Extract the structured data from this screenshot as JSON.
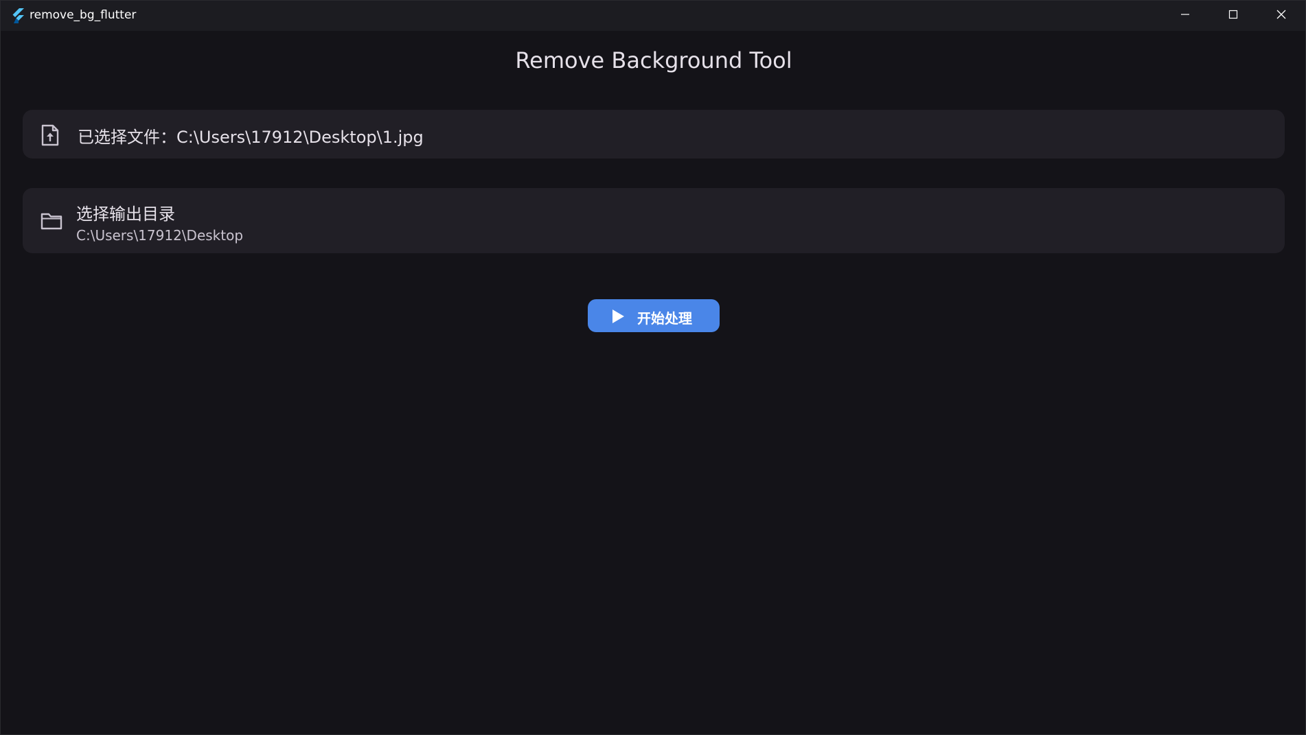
{
  "window": {
    "title": "remove_bg_flutter",
    "app_icon": "flutter-logo-icon",
    "controls": {
      "minimize_icon": "minimize-icon",
      "maximize_icon": "maximize-icon",
      "close_icon": "close-icon"
    }
  },
  "main": {
    "title": "Remove Background Tool",
    "file_card": {
      "icon": "file-upload-icon",
      "text": "已选择文件：C:\\Users\\17912\\Desktop\\1.jpg"
    },
    "output_card": {
      "icon": "folder-icon",
      "title": "选择输出目录",
      "path": "C:\\Users\\17912\\Desktop"
    },
    "start_button": {
      "icon": "play-icon",
      "label": "开始处理"
    }
  },
  "colors": {
    "background": "#141318",
    "titlebar": "#1c1c21",
    "card": "#211f26",
    "accent": "#4a86e8",
    "text": "#e6e1e9"
  }
}
